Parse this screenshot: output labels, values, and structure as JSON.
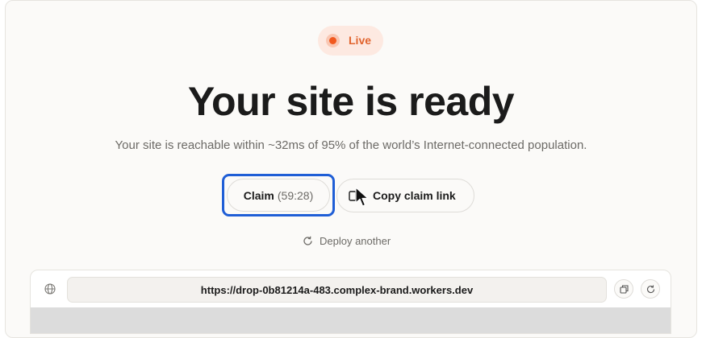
{
  "status_badge": {
    "label": "Live",
    "accent": "#f1591f"
  },
  "hero": {
    "title": "Your site is ready",
    "subtitle": "Your site is reachable within ~32ms of 95% of the world’s Internet-connected population."
  },
  "actions": {
    "claim_label": "Claim",
    "claim_timer": "(59:28)",
    "copy_label": "Copy claim link",
    "deploy_another": "Deploy another"
  },
  "preview": {
    "url": "https://drop-0b81214a-483.complex-brand.workers.dev",
    "icons": [
      "globe-icon",
      "open-in-new-window-icon",
      "reload-icon"
    ]
  },
  "colors": {
    "focus_ring": "#1f5ed6",
    "badge_bg": "#fde9e1"
  }
}
